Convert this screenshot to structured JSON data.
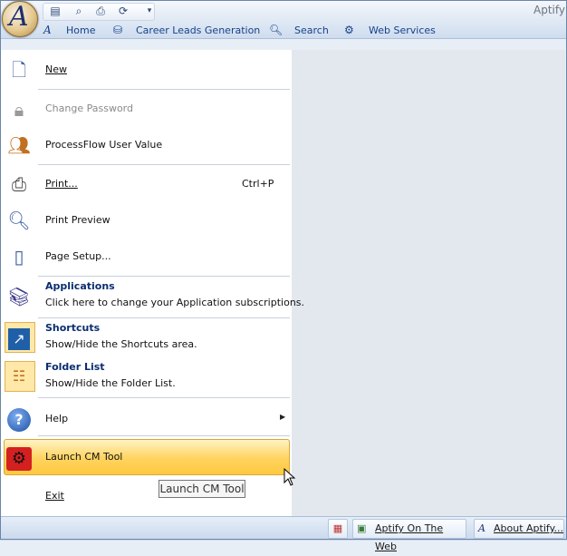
{
  "window": {
    "title": "Aptify"
  },
  "quick_access": {
    "items": [
      "document-icon",
      "preview-icon",
      "print-icon",
      "refresh-icon",
      "dropdown-icon"
    ]
  },
  "ribbon_tabs": [
    {
      "label": "Home",
      "icon": "aptify-icon"
    },
    {
      "label": "Career Leads Generation",
      "icon": "database-icon"
    },
    {
      "label": "Search",
      "icon": "search-icon"
    },
    {
      "label": "Web Services",
      "icon": "web-services-icon"
    }
  ],
  "menu": {
    "new": "New",
    "change_password": "Change Password",
    "processflow_user_value": "ProcessFlow User Value",
    "print": "Print...",
    "print_shortcut": "Ctrl+P",
    "print_preview": "Print Preview",
    "page_setup": "Page Setup...",
    "applications": {
      "title": "Applications",
      "desc": "Click here to change your Application subscriptions."
    },
    "shortcuts": {
      "title": "Shortcuts",
      "desc": "Show/Hide the Shortcuts area."
    },
    "folder_list": {
      "title": "Folder List",
      "desc": "Show/Hide the Folder List."
    },
    "help": "Help",
    "launch_cm_tool": "Launch CM Tool",
    "exit": "Exit"
  },
  "tooltip": "Launch CM Tool",
  "status_bar": {
    "aptify_on_the_web": "Aptify On The Web",
    "about_aptify": "About Aptify..."
  },
  "colors": {
    "accent": "#15428b",
    "highlight": "#ffd35e"
  }
}
